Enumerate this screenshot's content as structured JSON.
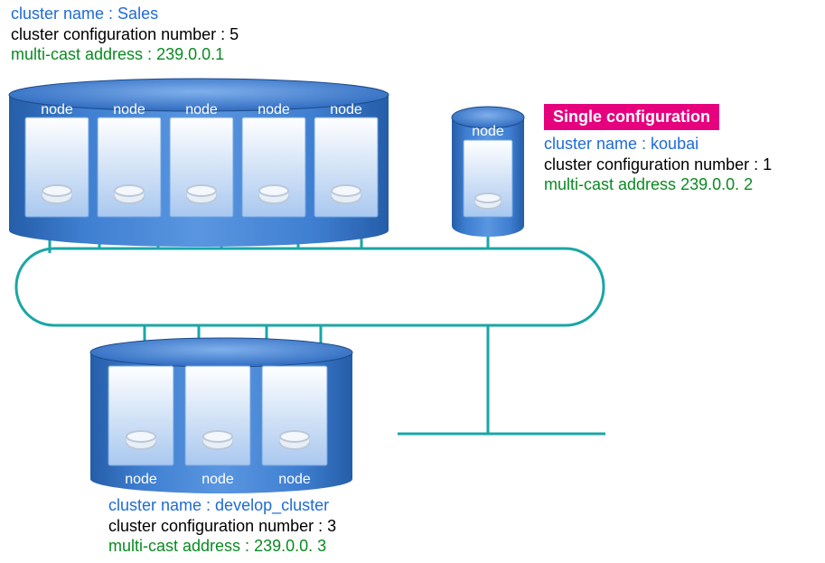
{
  "clusters": {
    "sales": {
      "name_label": "cluster  name : ",
      "name_value": "Sales",
      "config_label": "cluster configuration number : ",
      "config_value": "5",
      "mcast_label": "multi-cast address : ",
      "mcast_value": "239.0.0.1",
      "node_label": "node",
      "node_count": 5
    },
    "koubai": {
      "banner": "Single configuration",
      "name_label": "cluster  name : ",
      "name_value": "koubai",
      "config_label": "cluster configuration number : ",
      "config_value": "1",
      "mcast_label": "multi-cast address ",
      "mcast_value": "239.0.0. 2",
      "node_label": "node",
      "node_count": 1
    },
    "develop": {
      "name_label": "cluster  name : ",
      "name_value": "develop_cluster",
      "config_label": "cluster configuration number : ",
      "config_value": "3",
      "mcast_label": "multi-cast address : ",
      "mcast_value": "239.0.0. 3",
      "node_label": "node",
      "node_count": 3
    }
  },
  "colors": {
    "cylinder_fill": "#3f7fd1",
    "cylinder_stroke": "#1e4b8a",
    "node_fill_top": "#ffffff",
    "node_fill_bottom": "#a9c8ef",
    "node_stroke": "#6fa3e0",
    "disk_fill": "#e8eef6",
    "disk_stroke": "#bcc8d8",
    "bus_stroke": "#1aa6a6"
  }
}
